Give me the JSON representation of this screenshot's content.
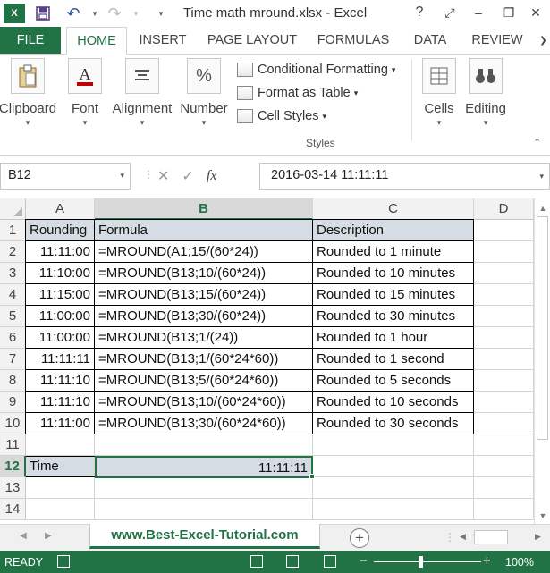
{
  "window": {
    "title": "Time math mround.xlsx - Excel",
    "help": "?",
    "ribbon_display": "⤢",
    "minimize": "–",
    "restore": "❐",
    "close": "✕"
  },
  "quick_access": {
    "save_icon": "save-icon",
    "undo_icon": "undo-icon",
    "redo_icon": "redo-icon"
  },
  "tabs": [
    {
      "label": "FILE"
    },
    {
      "label": "HOME"
    },
    {
      "label": "INSERT"
    },
    {
      "label": "PAGE LAYOUT"
    },
    {
      "label": "FORMULAS"
    },
    {
      "label": "DATA"
    },
    {
      "label": "REVIEW"
    }
  ],
  "ribbon": {
    "clipboard": "Clipboard",
    "font": "Font",
    "alignment": "Alignment",
    "number": "Number",
    "number_icon": "%",
    "conditional_formatting": "Conditional Formatting",
    "format_as_table": "Format as Table",
    "cell_styles": "Cell Styles",
    "styles_group": "Styles",
    "cells": "Cells",
    "editing": "Editing"
  },
  "formula_bar": {
    "name_box": "B12",
    "formula": "2016-03-14  11:11:11",
    "fx": "fx"
  },
  "columns": [
    "A",
    "B",
    "C",
    "D"
  ],
  "selected_column": "B",
  "rows": [
    "1",
    "2",
    "3",
    "4",
    "5",
    "6",
    "7",
    "8",
    "9",
    "10",
    "11",
    "12",
    "13",
    "14"
  ],
  "selected_row": "12",
  "table": {
    "header": {
      "a": "Rounding",
      "b": "Formula",
      "c": "Description"
    },
    "rows": [
      {
        "a": "11:11:00",
        "b": "=MROUND(A1;15/(60*24))",
        "c": "Rounded to 1 minute"
      },
      {
        "a": "11:10:00",
        "b": "=MROUND(B13;10/(60*24))",
        "c": "Rounded to 10 minutes"
      },
      {
        "a": "11:15:00",
        "b": "=MROUND(B13;15/(60*24))",
        "c": "Rounded to 15 minutes"
      },
      {
        "a": "11:00:00",
        "b": "=MROUND(B13;30/(60*24))",
        "c": "Rounded to 30 minutes"
      },
      {
        "a": "11:00:00",
        "b": "=MROUND(B13;1/(24))",
        "c": "Rounded to 1 hour"
      },
      {
        "a": "11:11:11",
        "b": "=MROUND(B13;1/(60*24*60))",
        "c": "Rounded to 1 second"
      },
      {
        "a": "11:11:10",
        "b": "=MROUND(B13;5/(60*24*60))",
        "c": "Rounded to 5 seconds"
      },
      {
        "a": "11:11:10",
        "b": "=MROUND(B13;10/(60*24*60))",
        "c": "Rounded to 10 seconds"
      },
      {
        "a": "11:11:00",
        "b": "=MROUND(B13;30/(60*24*60))",
        "c": "Rounded to 30 seconds"
      }
    ]
  },
  "row12": {
    "a": "Time",
    "b": "11:11:11"
  },
  "sheet": {
    "tab_label": "www.Best-Excel-Tutorial.com",
    "add": "+"
  },
  "status": {
    "ready": "READY",
    "zoom": "100%",
    "zoom_minus": "−",
    "zoom_plus": "+"
  },
  "colors": {
    "accent": "#217346",
    "header_fill": "#d6dce4"
  }
}
